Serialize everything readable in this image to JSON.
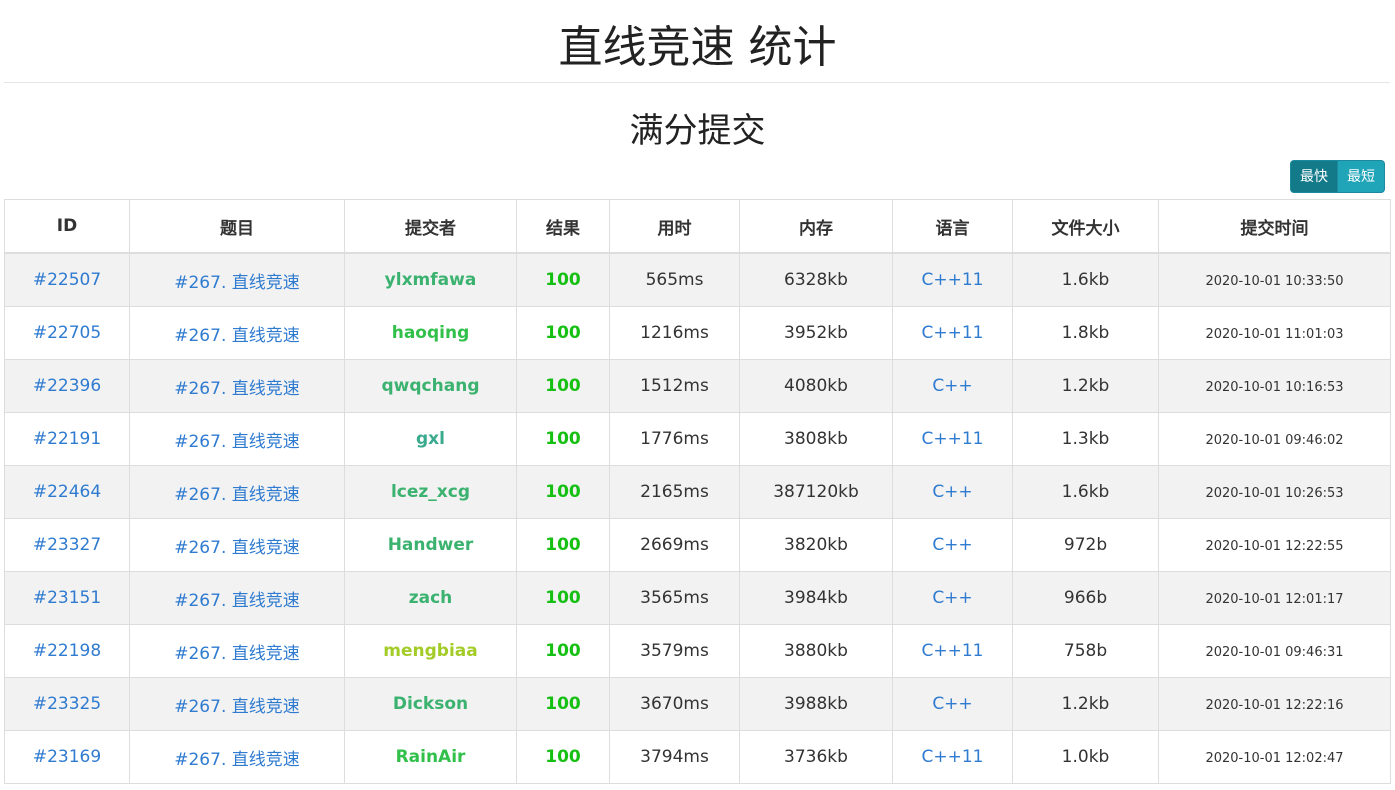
{
  "page_title": "直线竞速 统计",
  "section_title": "满分提交",
  "sort_buttons": [
    "最快",
    "最短"
  ],
  "columns": [
    "ID",
    "题目",
    "提交者",
    "结果",
    "用时",
    "内存",
    "语言",
    "文件大小",
    "提交时间"
  ],
  "rows": [
    {
      "id": "#22507",
      "problem": "#267. 直线竞速",
      "user": "ylxmfawa",
      "user_color": "#3bb26f",
      "score": "100",
      "time": "565ms",
      "memory": "6328kb",
      "language": "C++11",
      "size": "1.6kb",
      "submit_time": "2020-10-01 10:33:50"
    },
    {
      "id": "#22705",
      "problem": "#267. 直线竞速",
      "user": "haoqing",
      "user_color": "#31c04a",
      "score": "100",
      "time": "1216ms",
      "memory": "3952kb",
      "language": "C++11",
      "size": "1.8kb",
      "submit_time": "2020-10-01 11:01:03"
    },
    {
      "id": "#22396",
      "problem": "#267. 直线竞速",
      "user": "qwqchang",
      "user_color": "#3bb26f",
      "score": "100",
      "time": "1512ms",
      "memory": "4080kb",
      "language": "C++",
      "size": "1.2kb",
      "submit_time": "2020-10-01 10:16:53"
    },
    {
      "id": "#22191",
      "problem": "#267. 直线竞速",
      "user": "gxl",
      "user_color": "#3aaa8e",
      "score": "100",
      "time": "1776ms",
      "memory": "3808kb",
      "language": "C++11",
      "size": "1.3kb",
      "submit_time": "2020-10-01 09:46:02"
    },
    {
      "id": "#22464",
      "problem": "#267. 直线竞速",
      "user": "lcez_xcg",
      "user_color": "#3bb26f",
      "score": "100",
      "time": "2165ms",
      "memory": "387120kb",
      "language": "C++",
      "size": "1.6kb",
      "submit_time": "2020-10-01 10:26:53"
    },
    {
      "id": "#23327",
      "problem": "#267. 直线竞速",
      "user": "Handwer",
      "user_color": "#3bb26f",
      "score": "100",
      "time": "2669ms",
      "memory": "3820kb",
      "language": "C++",
      "size": "972b",
      "submit_time": "2020-10-01 12:22:55"
    },
    {
      "id": "#23151",
      "problem": "#267. 直线竞速",
      "user": "zach",
      "user_color": "#3bb26f",
      "score": "100",
      "time": "3565ms",
      "memory": "3984kb",
      "language": "C++",
      "size": "966b",
      "submit_time": "2020-10-01 12:01:17"
    },
    {
      "id": "#22198",
      "problem": "#267. 直线竞速",
      "user": "mengbiaa",
      "user_color": "#a4cc28",
      "score": "100",
      "time": "3579ms",
      "memory": "3880kb",
      "language": "C++11",
      "size": "758b",
      "submit_time": "2020-10-01 09:46:31"
    },
    {
      "id": "#23325",
      "problem": "#267. 直线竞速",
      "user": "Dickson",
      "user_color": "#3bb26f",
      "score": "100",
      "time": "3670ms",
      "memory": "3988kb",
      "language": "C++",
      "size": "1.2kb",
      "submit_time": "2020-10-01 12:22:16"
    },
    {
      "id": "#23169",
      "problem": "#267. 直线竞速",
      "user": "RainAir",
      "user_color": "#31c04a",
      "score": "100",
      "time": "3794ms",
      "memory": "3736kb",
      "language": "C++11",
      "size": "1.0kb",
      "submit_time": "2020-10-01 12:02:47"
    }
  ]
}
